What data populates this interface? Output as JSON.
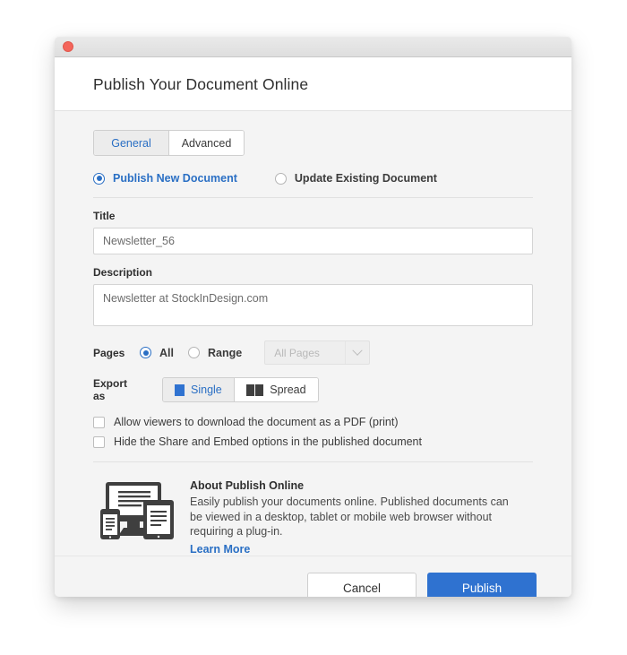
{
  "window": {
    "close_icon": "close-dot-icon",
    "header_title": "Publish Your Document Online"
  },
  "tabs": [
    {
      "label": "General",
      "active": true
    },
    {
      "label": "Advanced",
      "active": false
    }
  ],
  "publish_mode": {
    "options": [
      {
        "label": "Publish New Document",
        "selected": true
      },
      {
        "label": "Update Existing Document",
        "selected": false
      }
    ]
  },
  "title_field": {
    "label": "Title",
    "value": "Newsletter_56"
  },
  "description_field": {
    "label": "Description",
    "value": "Newsletter at StockInDesign.com"
  },
  "pages": {
    "label": "Pages",
    "options": [
      {
        "label": "All",
        "selected": true
      },
      {
        "label": "Range",
        "selected": false
      }
    ],
    "range_select": {
      "value": "All Pages",
      "disabled": true,
      "arrow_icon": "chevron-down-icon"
    }
  },
  "export_as": {
    "label": "Export as",
    "options": [
      {
        "label": "Single",
        "icon": "single-page-icon",
        "active": true
      },
      {
        "label": "Spread",
        "icon": "spread-pages-icon",
        "active": false
      }
    ]
  },
  "checkboxes": [
    {
      "label": "Allow viewers to download the document as a PDF (print)",
      "checked": false
    },
    {
      "label": "Hide the Share and Embed options in the published document",
      "checked": false
    }
  ],
  "about": {
    "illustration_icon": "devices-illustration-icon",
    "title": "About Publish Online",
    "description": "Easily publish your documents online. Published documents can be viewed in a desktop, tablet or mobile web browser without requiring a plug-in.",
    "link": "Learn More"
  },
  "footer": {
    "cancel_label": "Cancel",
    "publish_label": "Publish"
  },
  "colors": {
    "accent_blue": "#2a6fc4",
    "publish_button": "#2f72d0",
    "close_dot": "#f4655b",
    "body_bg": "#f4f4f4",
    "icon_dark": "#3f3f3f"
  }
}
